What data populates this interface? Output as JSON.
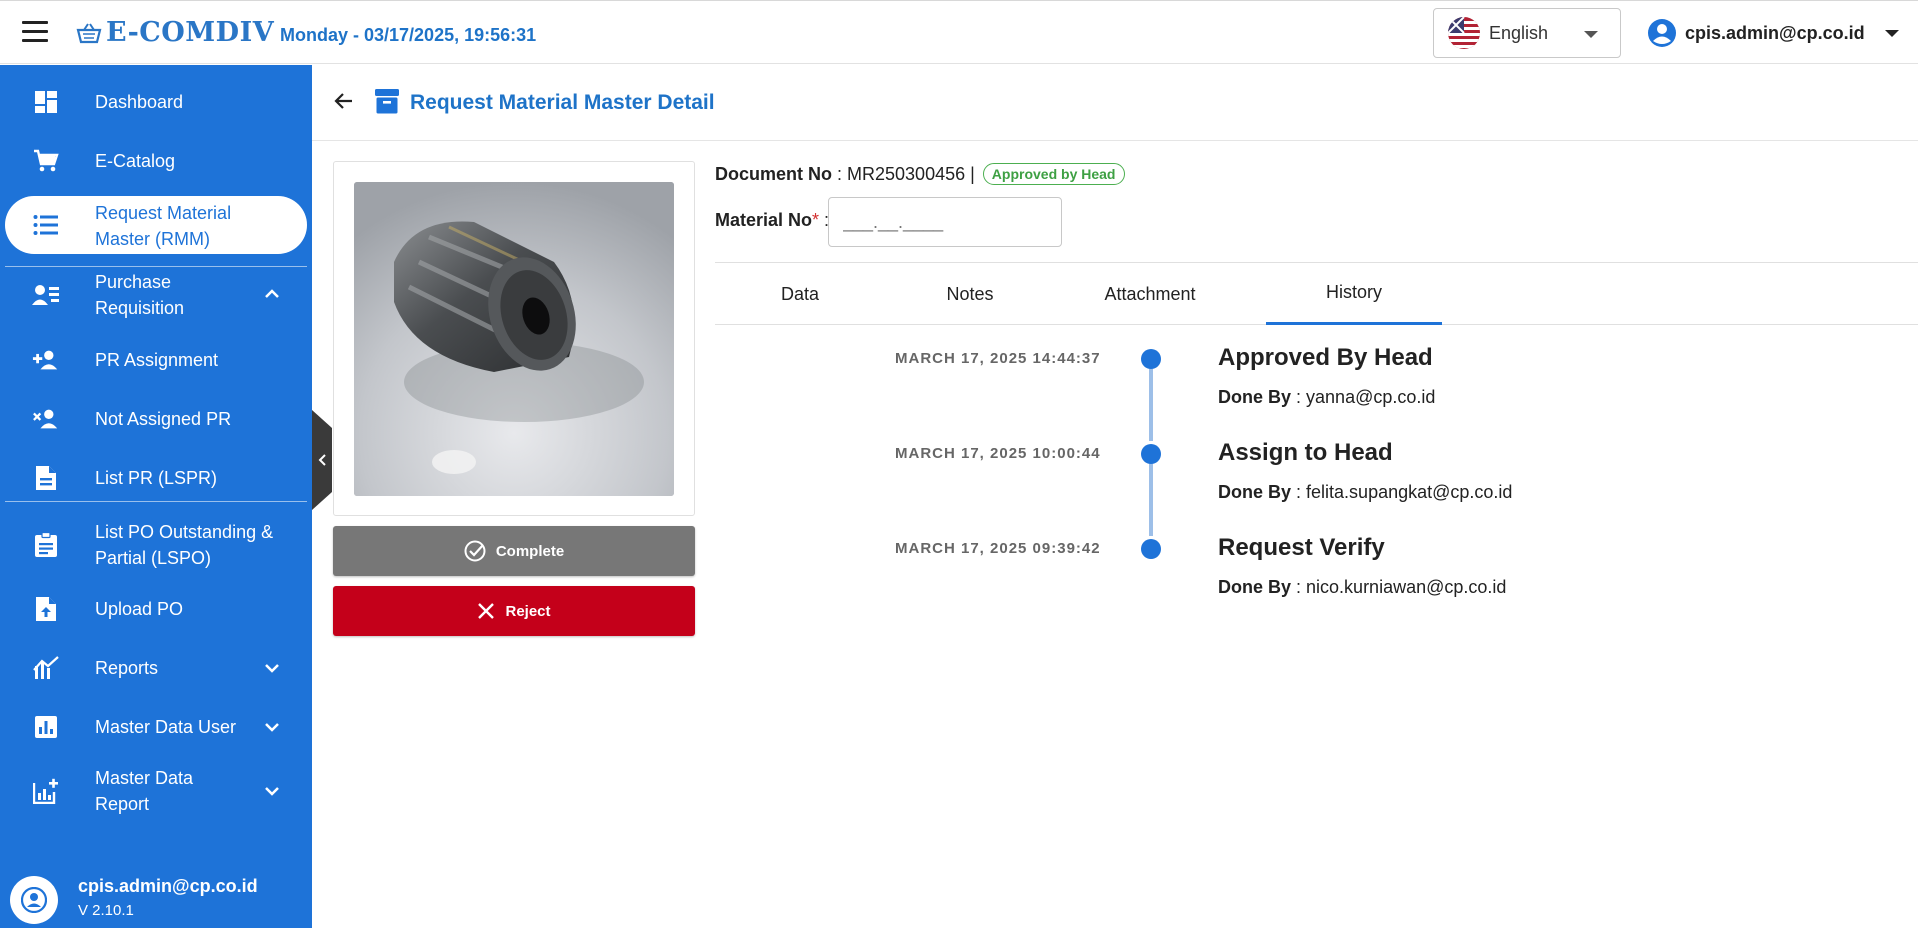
{
  "header": {
    "app_name": "E-COMDIV",
    "datetime": "Monday - 03/17/2025, 19:56:31",
    "language": "English",
    "user": "cpis.admin@cp.co.id"
  },
  "sidebar": {
    "items": [
      {
        "label": "Dashboard",
        "icon": "dashboard-icon"
      },
      {
        "label": "E-Catalog",
        "icon": "cart-icon"
      },
      {
        "label_line1": "Request Material",
        "label_line2": "Master (RMM)",
        "icon": "list-icon",
        "active": true
      },
      {
        "label_line1": "Purchase",
        "label_line2": "Requisition",
        "icon": "person-list-icon",
        "expanded": true
      },
      {
        "label": "PR Assignment",
        "icon": "person-add-icon"
      },
      {
        "label": "Not Assigned PR",
        "icon": "person-remove-icon"
      },
      {
        "label": "List PR (LSPR)",
        "icon": "document-icon"
      },
      {
        "label_line1": "List PO Outstanding &",
        "label_line2": "Partial (LSPO)",
        "icon": "clipboard-icon"
      },
      {
        "label": "Upload PO",
        "icon": "upload-file-icon"
      },
      {
        "label": "Reports",
        "icon": "chart-icon"
      },
      {
        "label": "Master Data User",
        "icon": "bar-chart-icon"
      },
      {
        "label_line1": "Master Data",
        "label_line2": "Report",
        "icon": "report-add-icon"
      }
    ],
    "footer": {
      "user": "cpis.admin@cp.co.id",
      "version": "V 2.10.1"
    }
  },
  "page": {
    "title": "Request Material Master Detail",
    "document_label": "Document No",
    "document_no": "MR250300456",
    "status_badge": "Approved by Head",
    "material_label": "Material No",
    "material_placeholder": "___.__.____",
    "buttons": {
      "complete": "Complete",
      "reject": "Reject"
    },
    "tabs": [
      "Data",
      "Notes",
      "Attachment",
      "History"
    ],
    "active_tab": "History"
  },
  "history": [
    {
      "date": "MARCH 17, 2025 14:44:37",
      "title": "Approved By Head",
      "done_by_label": "Done By",
      "done_by": "yanna@cp.co.id"
    },
    {
      "date": "MARCH 17, 2025 10:00:44",
      "title": "Assign to Head",
      "done_by_label": "Done By",
      "done_by": "felita.supangkat@cp.co.id"
    },
    {
      "date": "MARCH 17, 2025 09:39:42",
      "title": "Request Verify",
      "done_by_label": "Done By",
      "done_by": "nico.kurniawan@cp.co.id"
    }
  ],
  "colors": {
    "primary": "#1e73d8",
    "reject": "#c4001a",
    "complete": "#777777",
    "badge": "#4caf50"
  }
}
